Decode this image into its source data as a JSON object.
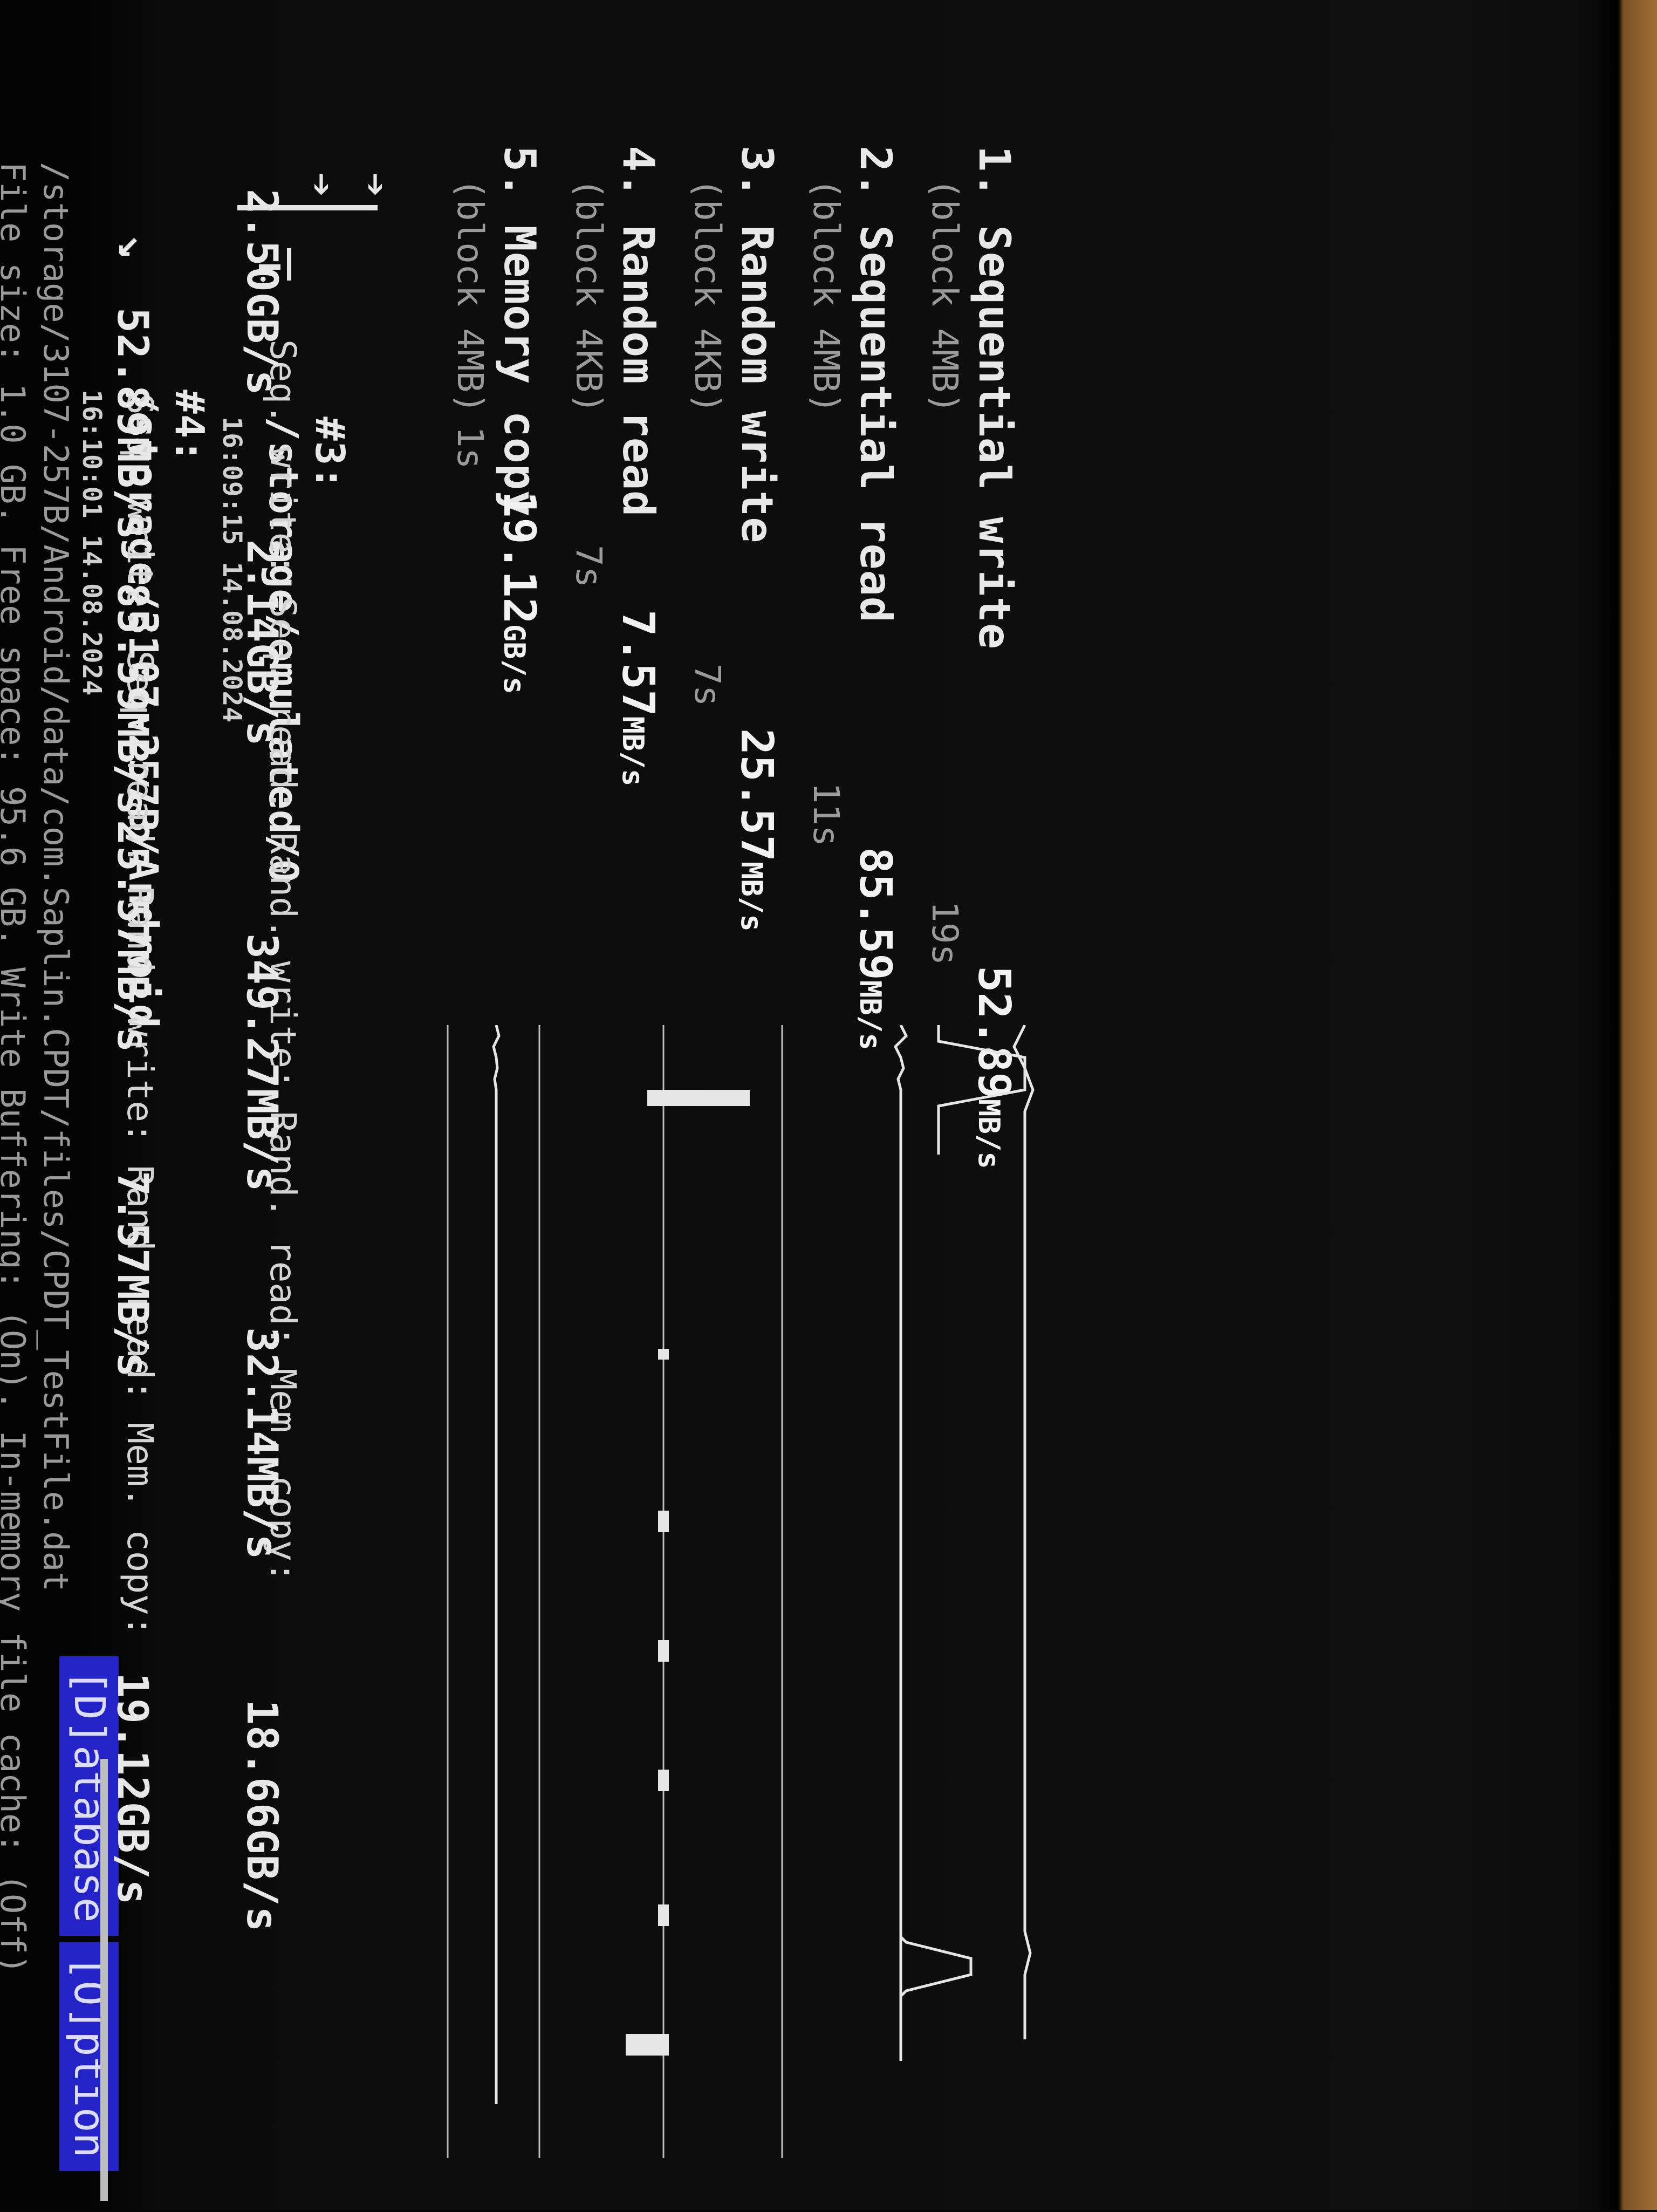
{
  "menu": {
    "database": "[D]atabase",
    "options": "[O]ption"
  },
  "results": [
    {
      "label": "#4:",
      "path": "/storage/3107-257B/Android",
      "timestamp": "16:10:01 14.08.2024",
      "summary": {
        "seq_write_label": "Seq. write:",
        "seq_write_value": "52.89MB/s",
        "seq_read_label": "Seq. read:",
        "seq_read_value": "85.59MB/s",
        "rand_write_label": "Rand. write:",
        "rand_write_value": "25.57MB/s",
        "rand_read_label": "Rand. read:",
        "rand_read_value": "7.57MB/s",
        "mem_copy_label": "Mem. copy:",
        "mem_copy_value": "19.12GB/s"
      }
    },
    {
      "label": "#3:",
      "path": "/storage/emulated/0",
      "timestamp": "16:09:15 14.08.2024",
      "summary": {
        "seq_write_label": "Seq. write:",
        "seq_write_value": "2.50GB/s",
        "seq_read_label": "Seq. read:",
        "seq_read_value": "2.14GB/s",
        "rand_write_label": "Rand. write:",
        "rand_write_value": "349.27MB/s",
        "rand_read_label": "Rand. read:",
        "rand_read_value": "32.14MB/s",
        "mem_copy_label": "Mem. copy:",
        "mem_copy_value": "18.66GB/s"
      }
    }
  ],
  "details": {
    "file_path": "/storage/3107-257B/Android/data/com.Saplin.CPDT/files/CPDT_TestFile.dat",
    "file_info": "File size: 1.0 GB. Free space: 95.6 GB. Write Buffering: (On). In-memory file cache: (Off)",
    "tests": [
      {
        "name": "1. Sequential write",
        "block": "(block 4MB)",
        "value": "52.89",
        "unit": "MB/s",
        "time": "19s"
      },
      {
        "name": "2. Sequential read",
        "block": "(block 4MB)",
        "value": "85.59",
        "unit": "MB/s",
        "time": "11s"
      },
      {
        "name": "3. Random write",
        "block": "(block 4KB)",
        "value": "25.57",
        "unit": "MB/s",
        "time": "7s"
      },
      {
        "name": "4. Random read",
        "block": "(block 4KB)",
        "value": "7.57",
        "unit": "MB/s",
        "time": "7s"
      },
      {
        "name": "5. Memory copy",
        "block": "(block 4MB)",
        "value": "19.12",
        "unit": "GB/s",
        "time": "1s"
      }
    ]
  },
  "arrows": {
    "expanded": "↘",
    "collapsed": "➔"
  }
}
